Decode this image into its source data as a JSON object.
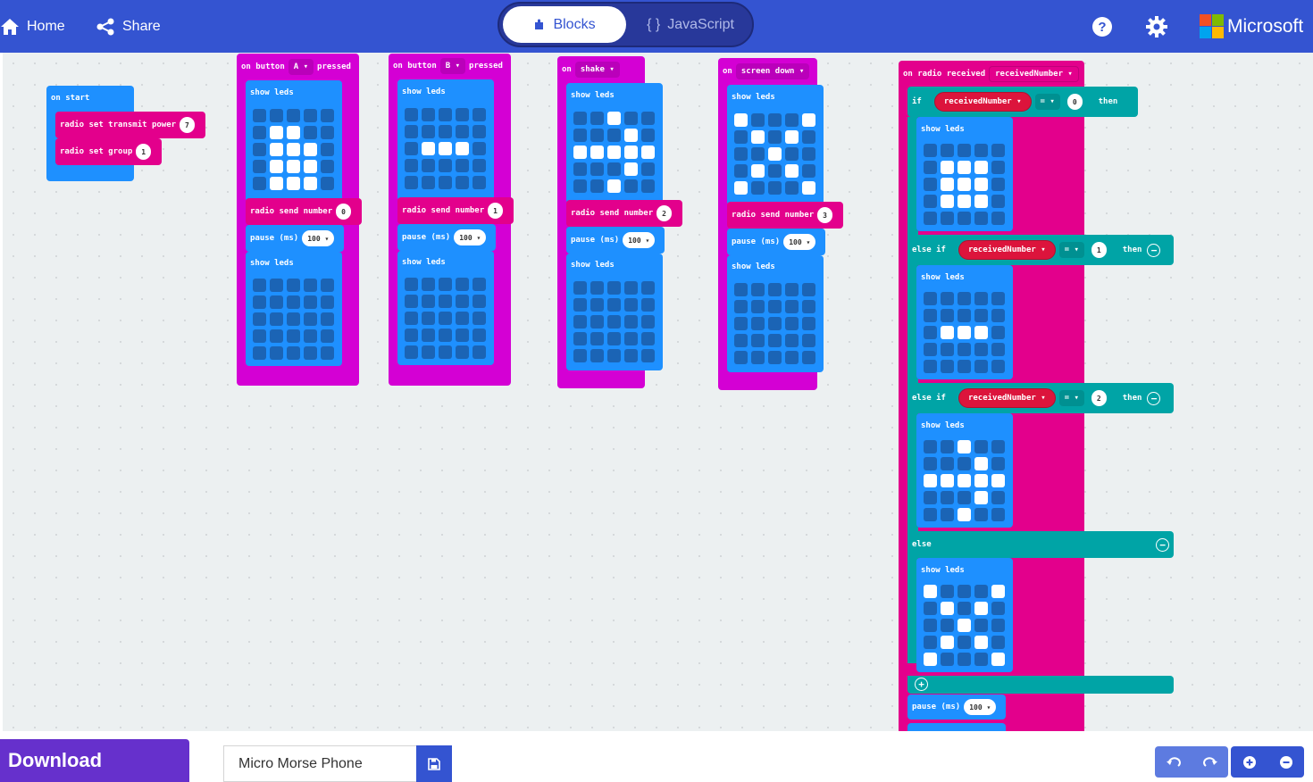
{
  "header": {
    "home_label": "Home",
    "share_label": "Share",
    "tabs": [
      {
        "label": "Blocks"
      },
      {
        "label": "JavaScript"
      }
    ],
    "brand": "Microsoft",
    "help_icon": "question-circle-icon",
    "settings_icon": "gear-icon"
  },
  "colors": {
    "header": "#3454d1",
    "radio": "#e3008c",
    "basic": "#1e90ff",
    "input": "#d400d4",
    "logic": "#00a4a6",
    "variable": "#dc143c",
    "download": "#6630cc"
  },
  "workspace": {
    "on_start": {
      "label": "on start",
      "power_label": "radio set transmit power",
      "power_value": "7",
      "group_label": "radio set group",
      "group_value": "1"
    },
    "common": {
      "show_leds": "show leds",
      "radio_send": "radio send number",
      "pause": "pause (ms)",
      "pause_value": "100"
    },
    "button_a": {
      "prefix": "on button",
      "button": "A",
      "suffix": "pressed",
      "send_value": "0"
    },
    "button_b": {
      "prefix": "on button",
      "button": "B",
      "suffix": "pressed",
      "send_value": "1"
    },
    "shake": {
      "prefix": "on",
      "gesture": "shake",
      "send_value": "2"
    },
    "screen_down": {
      "prefix": "on",
      "gesture": "screen down",
      "send_value": "3"
    },
    "radio_received": {
      "label": "on radio received",
      "var": "receivedNumber",
      "if_label": "if",
      "else_if_label": "else if",
      "else_label": "else",
      "then_label": "then",
      "op": "=",
      "cmp_values": [
        "0",
        "1",
        "2"
      ]
    },
    "led_patterns": {
      "a_1": [
        0,
        0,
        0,
        0,
        0,
        0,
        1,
        1,
        0,
        0,
        0,
        1,
        1,
        1,
        0,
        0,
        1,
        1,
        1,
        0,
        0,
        1,
        1,
        1,
        0
      ],
      "b_1": [
        0,
        0,
        0,
        0,
        0,
        0,
        0,
        0,
        0,
        0,
        0,
        1,
        1,
        1,
        0,
        0,
        0,
        0,
        0,
        0,
        0,
        0,
        0,
        0,
        0
      ],
      "shake_1": [
        0,
        0,
        1,
        0,
        0,
        0,
        0,
        0,
        1,
        0,
        1,
        1,
        1,
        1,
        1,
        0,
        0,
        0,
        1,
        0,
        0,
        0,
        1,
        0,
        0
      ],
      "down_1": [
        1,
        0,
        0,
        0,
        1,
        0,
        1,
        0,
        1,
        0,
        0,
        0,
        1,
        0,
        0,
        0,
        1,
        0,
        1,
        0,
        1,
        0,
        0,
        0,
        1
      ],
      "blank": [
        0,
        0,
        0,
        0,
        0,
        0,
        0,
        0,
        0,
        0,
        0,
        0,
        0,
        0,
        0,
        0,
        0,
        0,
        0,
        0,
        0,
        0,
        0,
        0,
        0
      ],
      "recv_0": [
        0,
        0,
        0,
        0,
        0,
        0,
        1,
        1,
        1,
        0,
        0,
        1,
        1,
        1,
        0,
        0,
        1,
        1,
        1,
        0,
        0,
        0,
        0,
        0,
        0
      ],
      "recv_1": [
        0,
        0,
        0,
        0,
        0,
        0,
        0,
        0,
        0,
        0,
        0,
        1,
        1,
        1,
        0,
        0,
        0,
        0,
        0,
        0,
        0,
        0,
        0,
        0,
        0
      ],
      "recv_2": [
        0,
        0,
        1,
        0,
        0,
        0,
        0,
        0,
        1,
        0,
        1,
        1,
        1,
        1,
        1,
        0,
        0,
        0,
        1,
        0,
        0,
        0,
        1,
        0,
        0
      ],
      "recv_else": [
        1,
        0,
        0,
        0,
        1,
        0,
        1,
        0,
        1,
        0,
        0,
        0,
        1,
        0,
        0,
        0,
        1,
        0,
        1,
        0,
        1,
        0,
        0,
        0,
        1
      ]
    }
  },
  "footer": {
    "download_label": "Download",
    "project_name": "Micro Morse Phone",
    "save_icon": "save-icon",
    "undo_icon": "undo-icon",
    "redo_icon": "redo-icon",
    "zoom_in_icon": "zoom-in-icon",
    "zoom_out_icon": "zoom-out-icon"
  }
}
